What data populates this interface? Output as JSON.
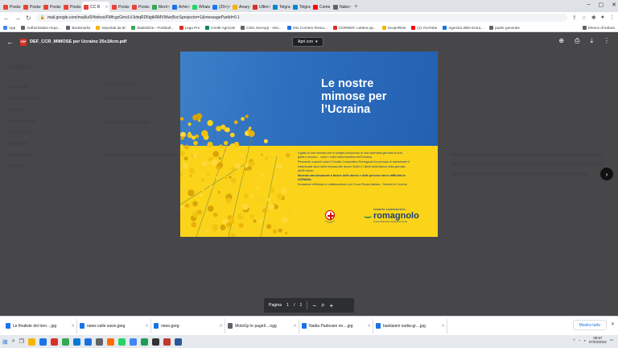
{
  "browser": {
    "tabs": [
      {
        "label": "Posta",
        "color": "#ea4335"
      },
      {
        "label": "Posta",
        "color": "#ea4335"
      },
      {
        "label": "Posta",
        "color": "#ea4335"
      },
      {
        "label": "Posta",
        "color": "#ea4335"
      },
      {
        "label": "CC R",
        "color": "#ea4335",
        "active": true
      },
      {
        "label": "Posta",
        "color": "#ea4335"
      },
      {
        "label": "Posta",
        "color": "#ea4335"
      },
      {
        "label": "Morri",
        "color": "#34a853"
      },
      {
        "label": "Arhiv",
        "color": "#1a73e8"
      },
      {
        "label": "Whats",
        "color": "#25d366"
      },
      {
        "label": "(20+)",
        "color": "#1877f2"
      },
      {
        "label": "Anary",
        "color": "#f4b400"
      },
      {
        "label": "Ultim",
        "color": "#d93025"
      },
      {
        "label": "Telgra",
        "color": "#0088cc"
      },
      {
        "label": "Telgra",
        "color": "#0088cc"
      },
      {
        "label": "Come",
        "color": "#ff0000"
      },
      {
        "label": "Nabo",
        "color": "#5f6368"
      }
    ],
    "new_tab": "+",
    "url": "mail.google.com/mail/u/0/#inbox/FMfcgzGmvLVJvbqRDNgtkRMVWwd5vcSprojector=1&messagePartId=0.1",
    "bookmarks": [
      {
        "label": "App",
        "color": "#4285f4"
      },
      {
        "label": "Authorization requi...",
        "color": "#5f6368"
      },
      {
        "label": "Bookmarks",
        "color": "#5f6368"
      },
      {
        "label": "Importati da IE",
        "color": "#f4b400"
      },
      {
        "label": "Statistiche - Football...",
        "color": "#34a853"
      },
      {
        "label": "Lega Pro",
        "color": "#d93025"
      },
      {
        "label": "Credit Agricole",
        "color": "#0a8a55"
      },
      {
        "label": "Citrix XenApp - Inst...",
        "color": "#5f6368"
      },
      {
        "label": "Sito Corriere Roma...",
        "color": "#1a73e8"
      },
      {
        "label": "CORNER: Lettera ap...",
        "color": "#d93025"
      },
      {
        "label": "ScopriRete",
        "color": "#f4b400"
      },
      {
        "label": "(1) YouTube",
        "color": "#ff0000"
      },
      {
        "label": "Agenzia delle Entra...",
        "color": "#1a73e8"
      },
      {
        "label": "padre generale",
        "color": "#5f6368"
      }
    ],
    "reading_list": "Elenco di lettura"
  },
  "viewer": {
    "filename": "DEF_CCR_MIMOSE per Ucraino 25x18cm.pdf",
    "pdf_badge": "PDF",
    "open_with": "Apri con",
    "page_label": "Pagina",
    "current_page": "1",
    "page_sep": "/",
    "total_pages": "1"
  },
  "pdf_page": {
    "title_lines": [
      "Le nostre",
      "mimose per",
      "l’Ucraina"
    ],
    "body": [
      "Il giallo di una mimosa che si sveglia sull’azzurro di una splendida giornata di sole, giallo e azzurro... come i colori della bandiera dell’Ucraina.",
      "Pensando a questi colori il Credito Cooperativo Romagnolo ha pensato di trasformare il tradizionale dono della mimosa alle donne Socie e Clienti della Banca nella giornata dell’8 marzo,",
      "facendo una donazione a favore delle donne e delle persone ora in difficoltà in UCRAINA.",
      "Donazione effettuata in collaborazione con Croce Rossa Italiana - Sezione di Cesena"
    ],
    "cri_label": "Croce Rossa Italiana",
    "ccr_top": "CREDITO COOPERATIVO",
    "ccr_name": "romagnolo",
    "ccr_sub": "Gruppo Bancario Cooperativo Iccrea"
  },
  "downloads": {
    "items": [
      {
        "name": "Le finaliste del torn....jpg",
        "color": "#1a73e8"
      },
      {
        "name": "news valle savio.jpeg",
        "color": "#1a73e8"
      },
      {
        "name": "news.jpeg",
        "color": "#1a73e8"
      },
      {
        "name": "MotoGp le pagell....ogg",
        "color": "#5f6368"
      },
      {
        "name": "Nadia Padovani en....jpg",
        "color": "#1a73e8"
      },
      {
        "name": "bastianini nadia-gr....jpg",
        "color": "#1a73e8"
      }
    ],
    "show_all": "Mostra tutto"
  },
  "taskbar": {
    "time": "09:57",
    "date": "07/03/2022",
    "apps": [
      "#f4b400",
      "#1a73e8",
      "#d93025",
      "#34a853",
      "#0078d7",
      "#1e6fd9",
      "#5f6368",
      "#ff6d00",
      "#25d366",
      "#4285f4",
      "#1f9d55",
      "#333333",
      "#c0392b",
      "#2b579a"
    ]
  }
}
